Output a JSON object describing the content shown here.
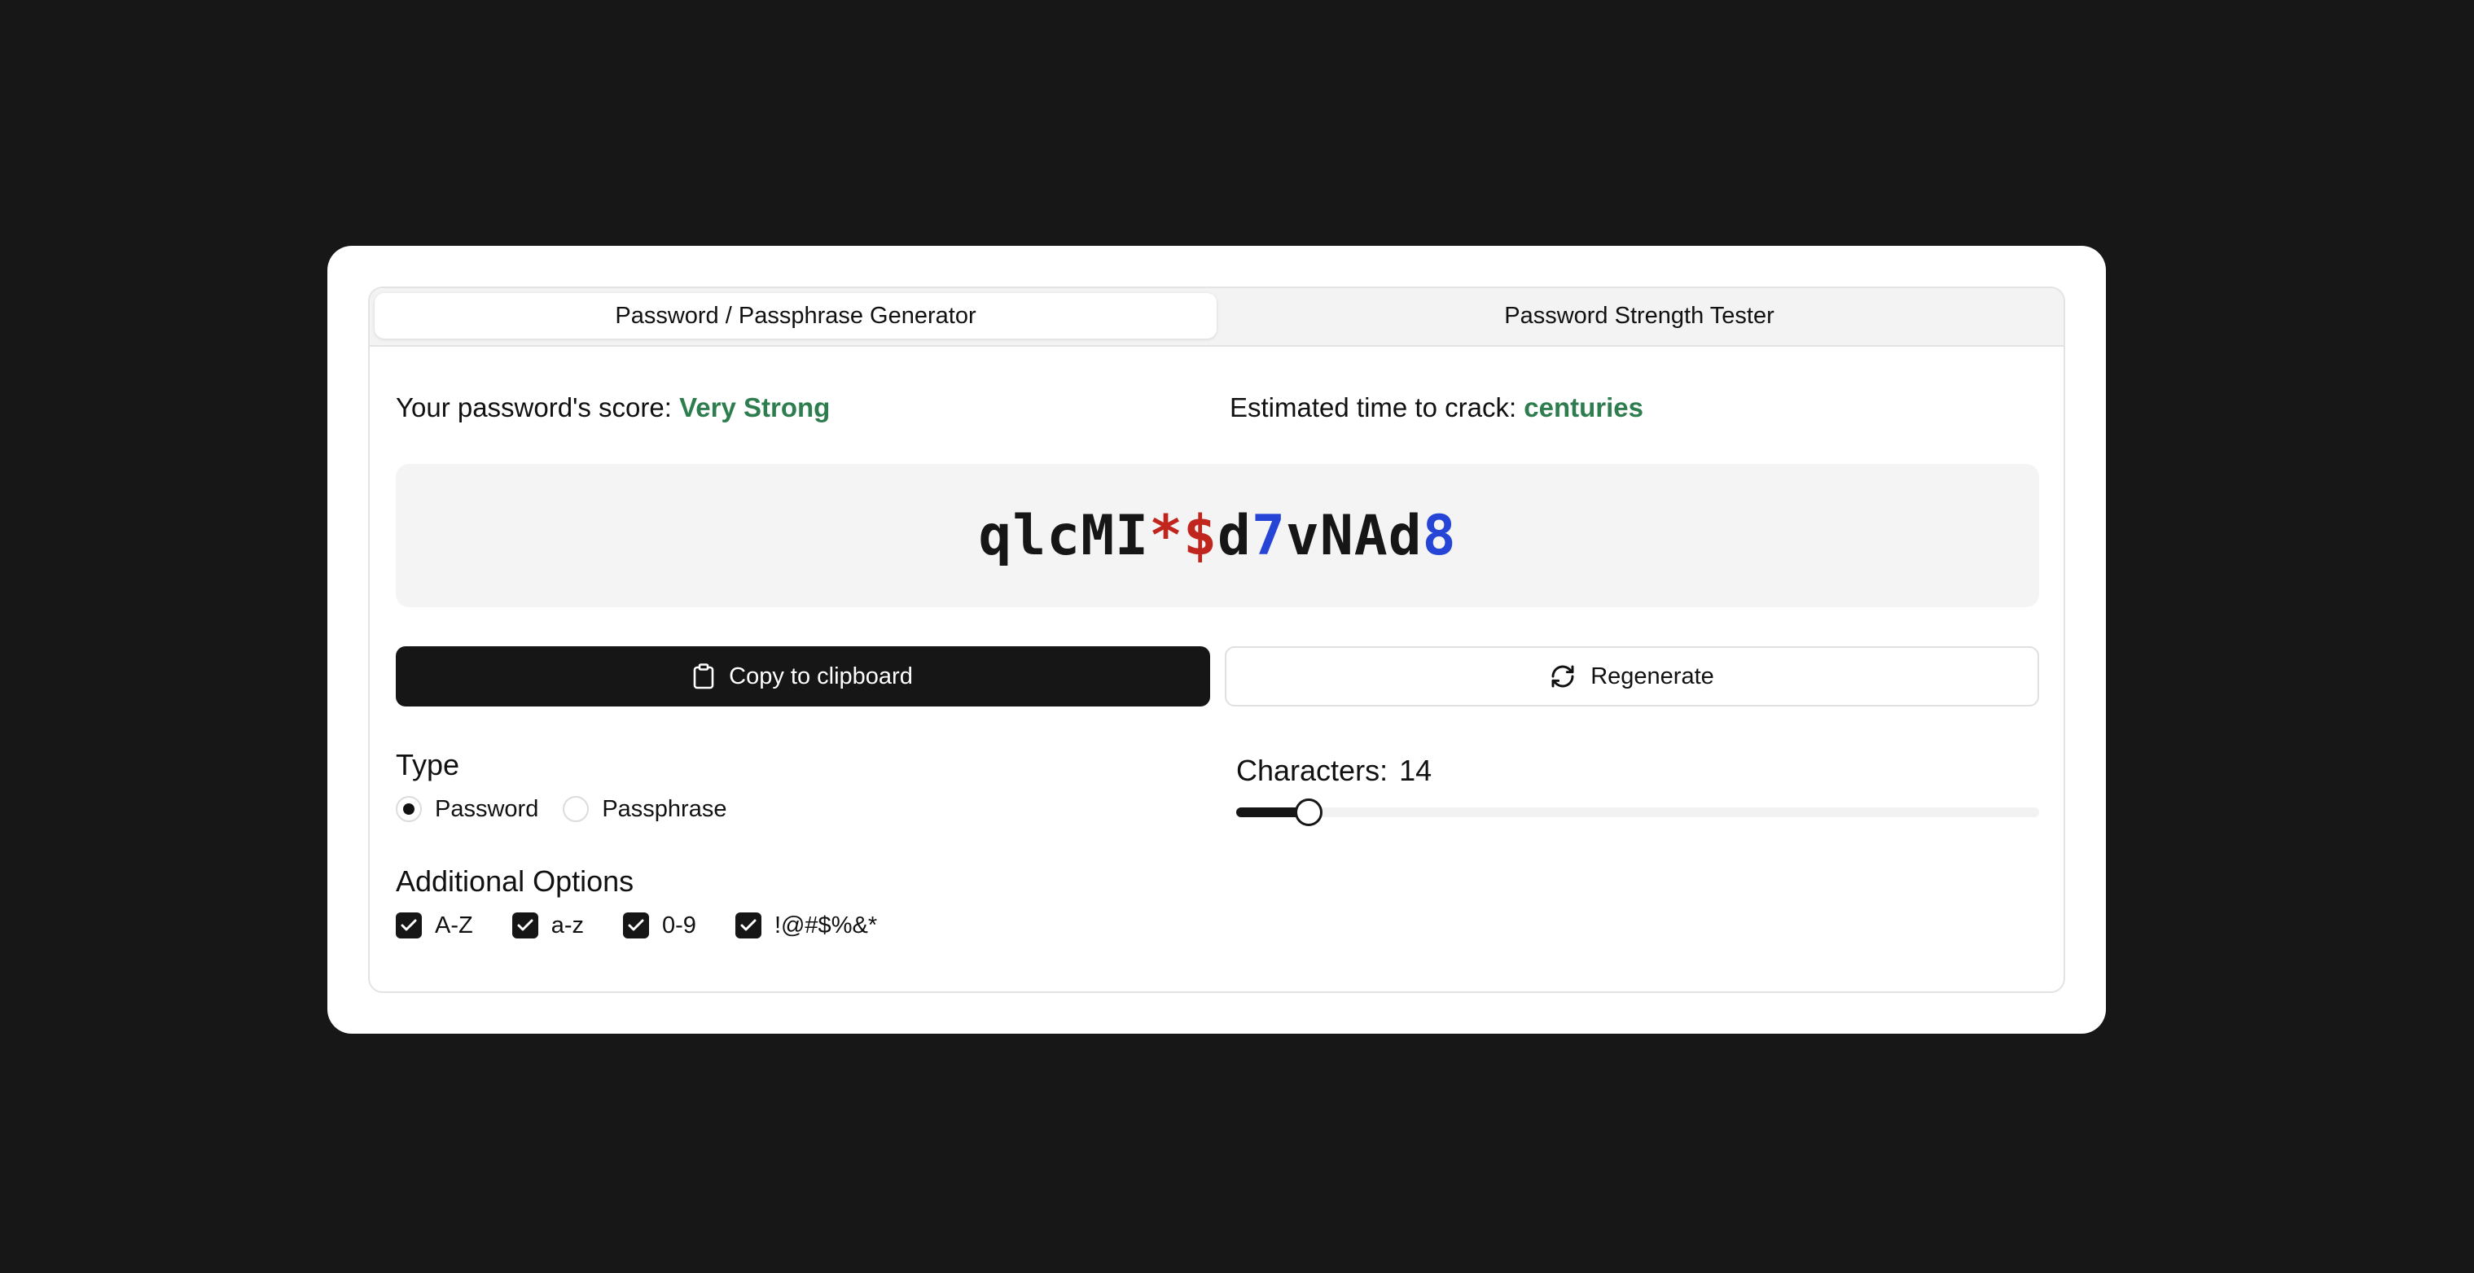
{
  "tabs": {
    "generator": "Password / Passphrase Generator",
    "tester": "Password Strength Tester",
    "active": "generator"
  },
  "score": {
    "label": "Your password's score:",
    "value": "Very Strong"
  },
  "crack_time": {
    "label": "Estimated time to crack:",
    "value": "centuries"
  },
  "password": {
    "value": "qlcMI*$d7vNAd8",
    "segments": [
      {
        "text": "qlcMI",
        "kind": "letter"
      },
      {
        "text": "*$",
        "kind": "symbol"
      },
      {
        "text": "d",
        "kind": "letter"
      },
      {
        "text": "7",
        "kind": "number"
      },
      {
        "text": "vNAd",
        "kind": "letter"
      },
      {
        "text": "8",
        "kind": "number"
      }
    ]
  },
  "actions": {
    "copy": "Copy to clipboard",
    "regenerate": "Regenerate"
  },
  "type": {
    "heading": "Type",
    "options": [
      "Password",
      "Passphrase"
    ],
    "selected": "Password"
  },
  "characters": {
    "label": "Characters:",
    "value": "14",
    "slider_fraction": 0.09
  },
  "additional_options": {
    "heading": "Additional Options",
    "items": [
      {
        "label": "A-Z",
        "checked": true
      },
      {
        "label": "a-z",
        "checked": true
      },
      {
        "label": "0-9",
        "checked": true
      },
      {
        "label": "!@#$%&*",
        "checked": true
      }
    ]
  },
  "colors": {
    "background": "#171717",
    "accent_dark": "#161616",
    "strength_green": "#2e7d4f",
    "symbol_red": "#c0261d",
    "number_blue": "#2645d6"
  },
  "icons": {
    "copy": "clipboard-icon",
    "regenerate": "refresh-icon",
    "check": "check-icon"
  }
}
